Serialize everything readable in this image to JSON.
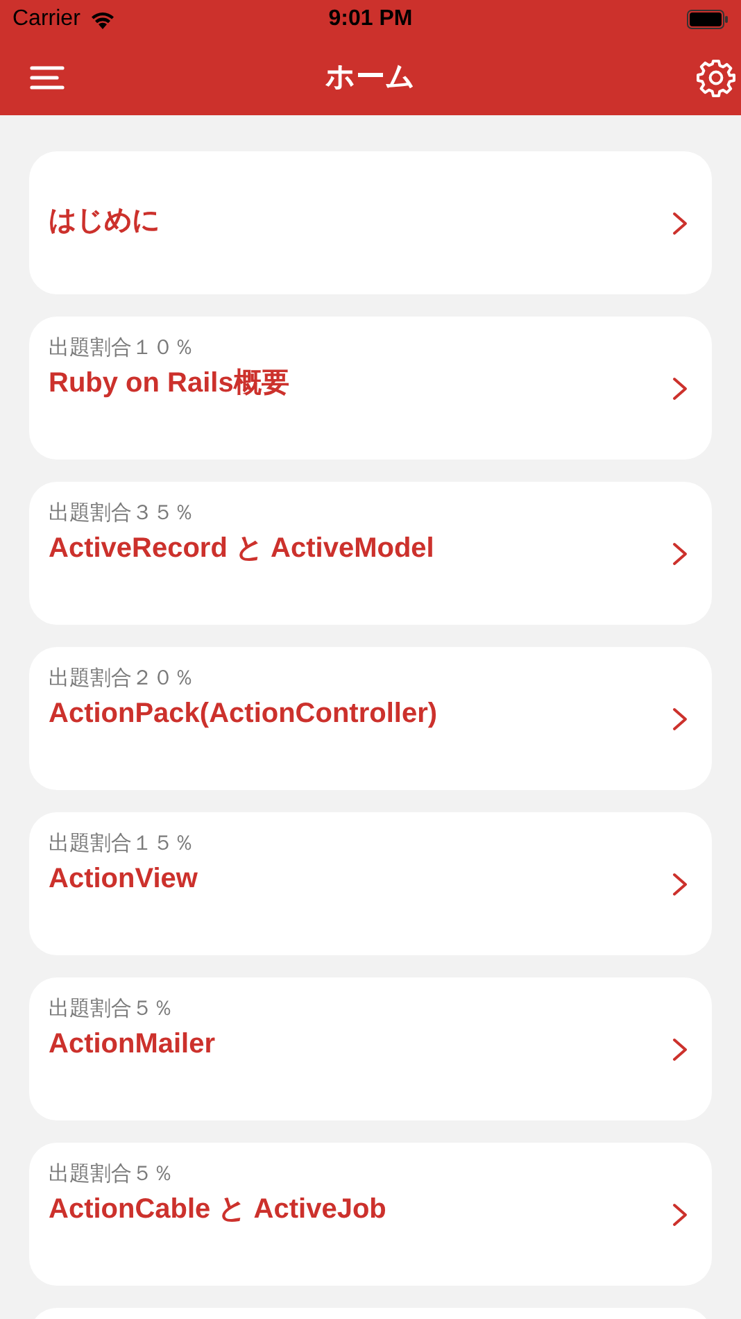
{
  "status_bar": {
    "carrier": "Carrier",
    "time": "9:01 PM"
  },
  "nav_bar": {
    "title": "ホーム"
  },
  "items": [
    {
      "title": "はじめに"
    },
    {
      "subtitle": "出題割合１０％",
      "title": "Ruby on Rails概要"
    },
    {
      "subtitle": "出題割合３５％",
      "title": "ActiveRecord と ActiveModel"
    },
    {
      "subtitle": "出題割合２０％",
      "title": "ActionPack(ActionController)"
    },
    {
      "subtitle": "出題割合１５％",
      "title": "ActionView"
    },
    {
      "subtitle": "出題割合５％",
      "title": "ActionMailer"
    },
    {
      "subtitle": "出題割合５％",
      "title": "ActionCable と ActiveJob"
    }
  ]
}
